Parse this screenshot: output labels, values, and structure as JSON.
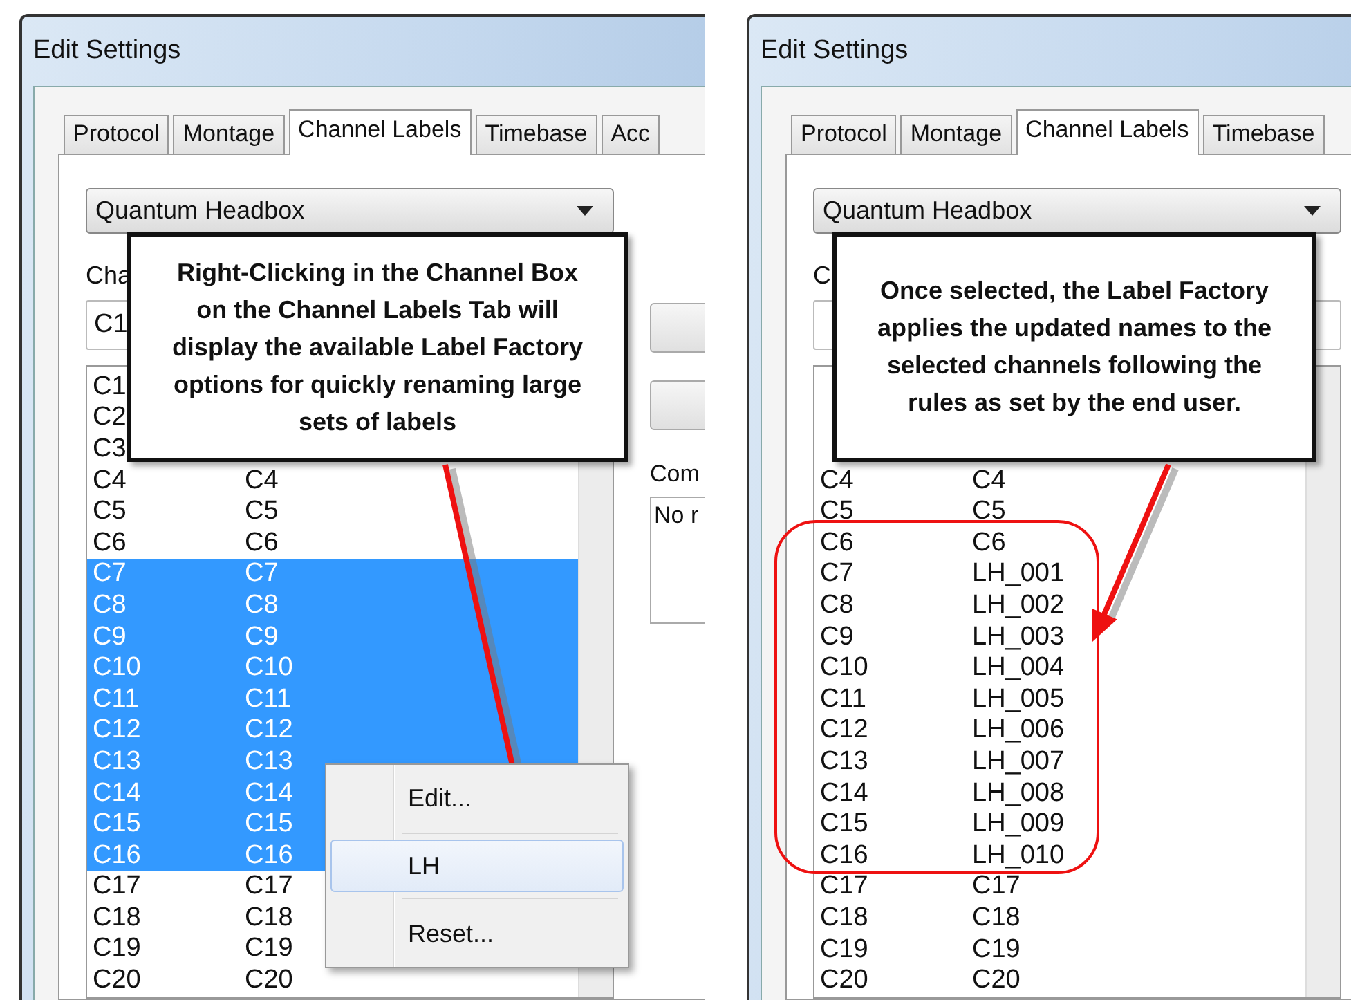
{
  "panels": [
    {
      "kind": "context-menu",
      "title": "Edit Settings",
      "tabs": [
        {
          "label": "Protocol",
          "selected": false
        },
        {
          "label": "Montage",
          "selected": false
        },
        {
          "label": "Channel Labels",
          "selected": true
        },
        {
          "label": "Timebase",
          "selected": false
        },
        {
          "label": "Acc",
          "selected": false
        }
      ],
      "device": "Quantum Headbox",
      "channel_label": "Cha",
      "channel_value": "C1",
      "rows": [
        {
          "channel": "C1",
          "selected": false
        },
        {
          "channel": "C2",
          "selected": false
        },
        {
          "channel": "C3",
          "selected": false
        },
        {
          "channel": "C4",
          "label": "C4",
          "selected": false
        },
        {
          "channel": "C5",
          "label": "C5",
          "selected": false
        },
        {
          "channel": "C6",
          "label": "C6",
          "selected": false
        },
        {
          "channel": "C7",
          "label": "C7",
          "selected": true
        },
        {
          "channel": "C8",
          "label": "C8",
          "selected": true
        },
        {
          "channel": "C9",
          "label": "C9",
          "selected": true
        },
        {
          "channel": "C10",
          "label": "C10",
          "selected": true
        },
        {
          "channel": "C11",
          "label": "C11",
          "selected": true
        },
        {
          "channel": "C12",
          "label": "C12",
          "selected": true
        },
        {
          "channel": "C13",
          "label": "C13",
          "selected": true
        },
        {
          "channel": "C14",
          "label": "C14",
          "selected": true
        },
        {
          "channel": "C15",
          "label": "C15",
          "selected": true
        },
        {
          "channel": "C16",
          "label": "C16",
          "selected": true
        },
        {
          "channel": "C17",
          "label": "C17",
          "selected": false
        },
        {
          "channel": "C18",
          "label": "C18",
          "selected": false
        },
        {
          "channel": "C19",
          "label": "C19",
          "selected": false
        },
        {
          "channel": "C20",
          "label": "C20",
          "selected": false
        }
      ],
      "side": {
        "comment_label": "Com",
        "comment": "No r"
      },
      "callout": "Right-Clicking in the Channel Box on the Channel Labels Tab will display the available Label Factory options for quickly renaming large sets of labels",
      "menu": [
        {
          "label": "Edit...",
          "selected": false
        },
        {
          "label": "LH",
          "selected": true
        },
        {
          "label": "Reset...",
          "selected": false
        }
      ]
    },
    {
      "kind": "result",
      "title": "Edit Settings",
      "tabs": [
        {
          "label": "Protocol",
          "selected": false
        },
        {
          "label": "Montage",
          "selected": false
        },
        {
          "label": "Channel Labels",
          "selected": true
        },
        {
          "label": "Timebase",
          "selected": false
        }
      ],
      "device": "Quantum Headbox",
      "channel_label": "C",
      "rows": [
        {
          "channel": "C4",
          "label": "C4",
          "selected": false
        },
        {
          "channel": "C5",
          "label": "C5",
          "selected": false
        },
        {
          "channel": "C6",
          "label": "C6",
          "selected": false
        },
        {
          "channel": "C7",
          "label": "LH_001",
          "selected": false
        },
        {
          "channel": "C8",
          "label": "LH_002",
          "selected": false
        },
        {
          "channel": "C9",
          "label": "LH_003",
          "selected": false
        },
        {
          "channel": "C10",
          "label": "LH_004",
          "selected": false
        },
        {
          "channel": "C11",
          "label": "LH_005",
          "selected": false
        },
        {
          "channel": "C12",
          "label": "LH_006",
          "selected": false
        },
        {
          "channel": "C13",
          "label": "LH_007",
          "selected": false
        },
        {
          "channel": "C14",
          "label": "LH_008",
          "selected": false
        },
        {
          "channel": "C15",
          "label": "LH_009",
          "selected": false
        },
        {
          "channel": "C16",
          "label": "LH_010",
          "selected": false
        },
        {
          "channel": "C17",
          "label": "C17",
          "selected": false
        },
        {
          "channel": "C18",
          "label": "C18",
          "selected": false
        },
        {
          "channel": "C19",
          "label": "C19",
          "selected": false
        },
        {
          "channel": "C20",
          "label": "C20",
          "selected": false
        }
      ],
      "callout": "Once selected, the Label Factory applies the updated names to the selected channels following the rules as set by the end user.",
      "ring": true
    }
  ]
}
